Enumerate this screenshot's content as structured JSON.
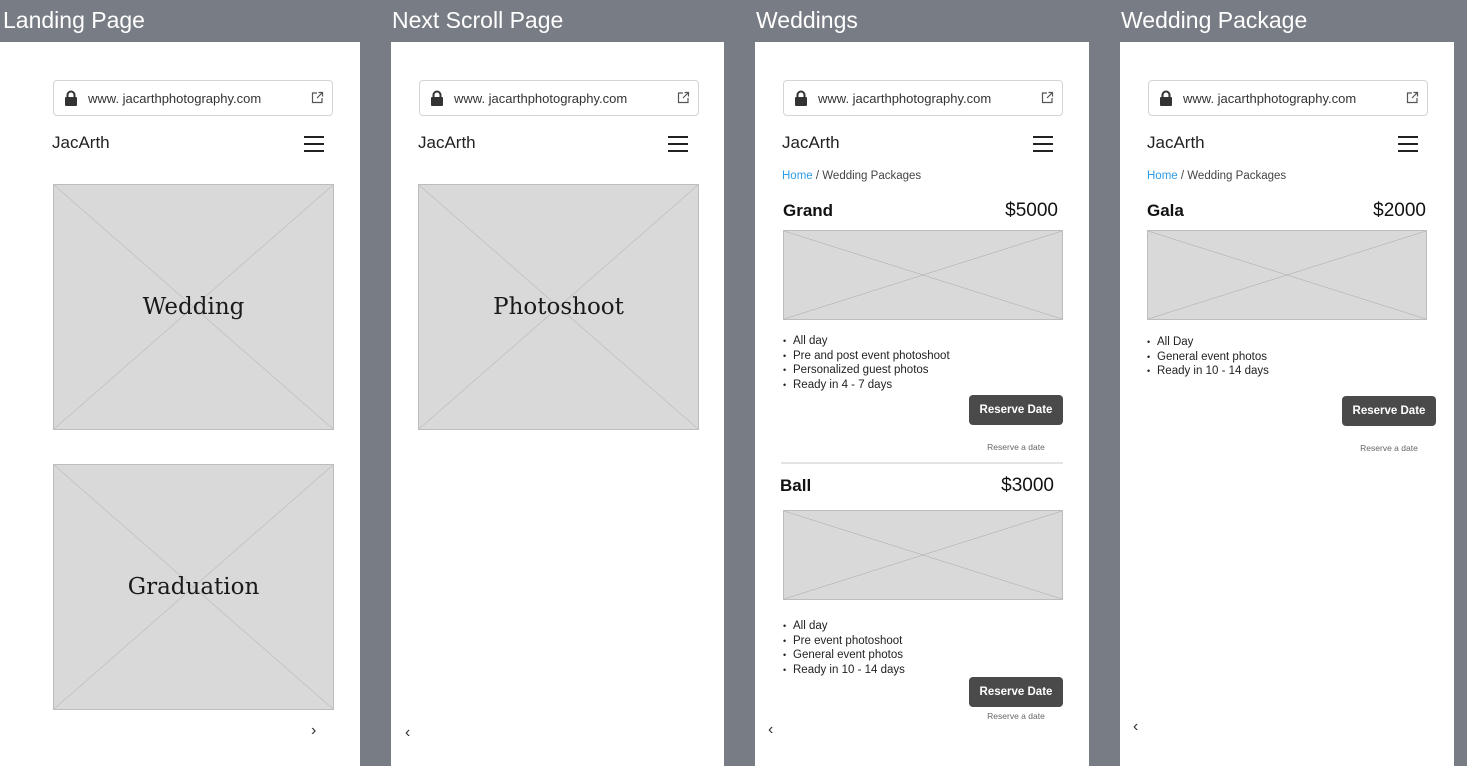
{
  "frames": [
    {
      "title": "Landing Page",
      "url": "www. jacarthphotography.com",
      "brand": "JacArth",
      "cards": [
        {
          "label": "Wedding"
        },
        {
          "label": "Graduation"
        }
      ],
      "nav_arrow": "›"
    },
    {
      "title": "Next Scroll Page",
      "url": "www. jacarthphotography.com",
      "brand": "JacArth",
      "cards": [
        {
          "label": "Photoshoot"
        }
      ],
      "nav_arrow": "‹"
    },
    {
      "title": "Weddings",
      "url": "www. jacarthphotography.com",
      "brand": "JacArth",
      "breadcrumb": {
        "home": "Home",
        "current": " / Wedding Packages"
      },
      "packages": [
        {
          "name": "Grand",
          "price": "$5000",
          "features": [
            "All day",
            "Pre and post event photoshoot",
            "Personalized guest photos",
            "Ready in 4 - 7 days"
          ],
          "button": "Reserve Date",
          "sub": "Reserve a date"
        },
        {
          "name": "Ball",
          "price": "$3000",
          "features": [
            "All day",
            "Pre event photoshoot",
            "General event photos",
            "Ready in 10 - 14 days"
          ],
          "button": "Reserve Date",
          "sub": "Reserve a date"
        }
      ],
      "nav_arrow": "‹"
    },
    {
      "title": "Wedding Package",
      "url": "www. jacarthphotography.com",
      "brand": "JacArth",
      "breadcrumb": {
        "home": "Home",
        "current": " / Wedding Packages"
      },
      "packages": [
        {
          "name": "Gala",
          "price": "$2000",
          "features": [
            "All Day",
            "General event photos",
            "Ready in 10 - 14 days"
          ],
          "button": "Reserve Date",
          "sub": "Reserve a date"
        }
      ],
      "nav_arrow": "‹"
    }
  ],
  "icons": {
    "url_lock": "lock-icon",
    "url_external": "external-link-icon",
    "menu": "hamburger-menu-icon"
  },
  "colors": {
    "frame_background": "#787c84",
    "placeholder": "#d9d9d9",
    "breadcrumb_link": "#2f9be5",
    "button": "#4a4a4a"
  }
}
